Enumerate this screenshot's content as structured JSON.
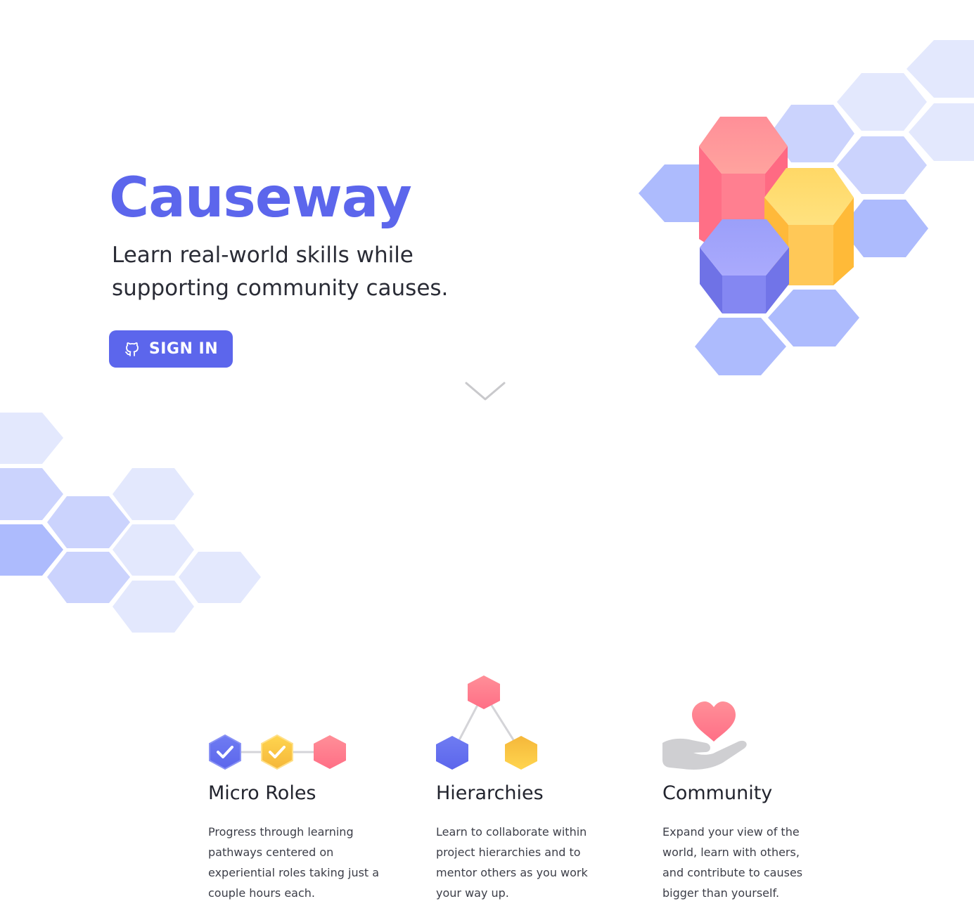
{
  "hero": {
    "title": "Causeway",
    "tagline": "Learn real-world skills while supporting community causes.",
    "signin": {
      "label": "SIGN IN",
      "icon": "github-icon"
    },
    "scroll_icon": "chevron-down-icon"
  },
  "colors": {
    "brand": "#5c66ec",
    "pink": "#ff6f86",
    "yellow": "#ffc94a",
    "purple": "#8a8ef5",
    "hex_light": "#e3e8fd",
    "hex_mid": "#cbd3fd",
    "hex_dark": "#adbbfd"
  },
  "features": [
    {
      "title": "Micro Roles",
      "icon": "micro-roles-icon",
      "description": "Progress through learning pathways centered on experiential roles taking just a couple hours each."
    },
    {
      "title": "Hierarchies",
      "icon": "hierarchy-icon",
      "description": "Learn to collaborate within project hierarchies and to mentor others as you work your way up."
    },
    {
      "title": "Community",
      "icon": "heart-hand-icon",
      "description": "Expand your view of the world, learn with others, and contribute to causes bigger than yourself."
    }
  ]
}
